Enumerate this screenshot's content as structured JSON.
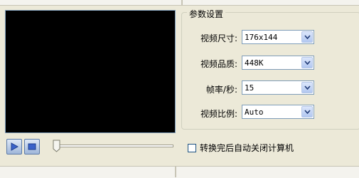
{
  "settings": {
    "title": "参数设置",
    "video_size": {
      "label": "视频尺寸:",
      "value": "176x144"
    },
    "video_quality": {
      "label": "视频品质:",
      "value": "448K"
    },
    "frame_rate": {
      "label": "帧率/秒:",
      "value": "15"
    },
    "aspect_ratio": {
      "label": "视频比例:",
      "value": "Auto"
    }
  },
  "player": {
    "progress": 0
  },
  "options": {
    "shutdown_after_convert": {
      "label": "转换完后自动关闭计算机",
      "checked": false
    }
  },
  "icons": {
    "play": "play-icon",
    "stop": "stop-icon",
    "dropdown": "chevron-down-icon"
  },
  "colors": {
    "preview_bg": "#000000",
    "window_bg": "#ece9d8",
    "accent": "#3a62c9"
  }
}
